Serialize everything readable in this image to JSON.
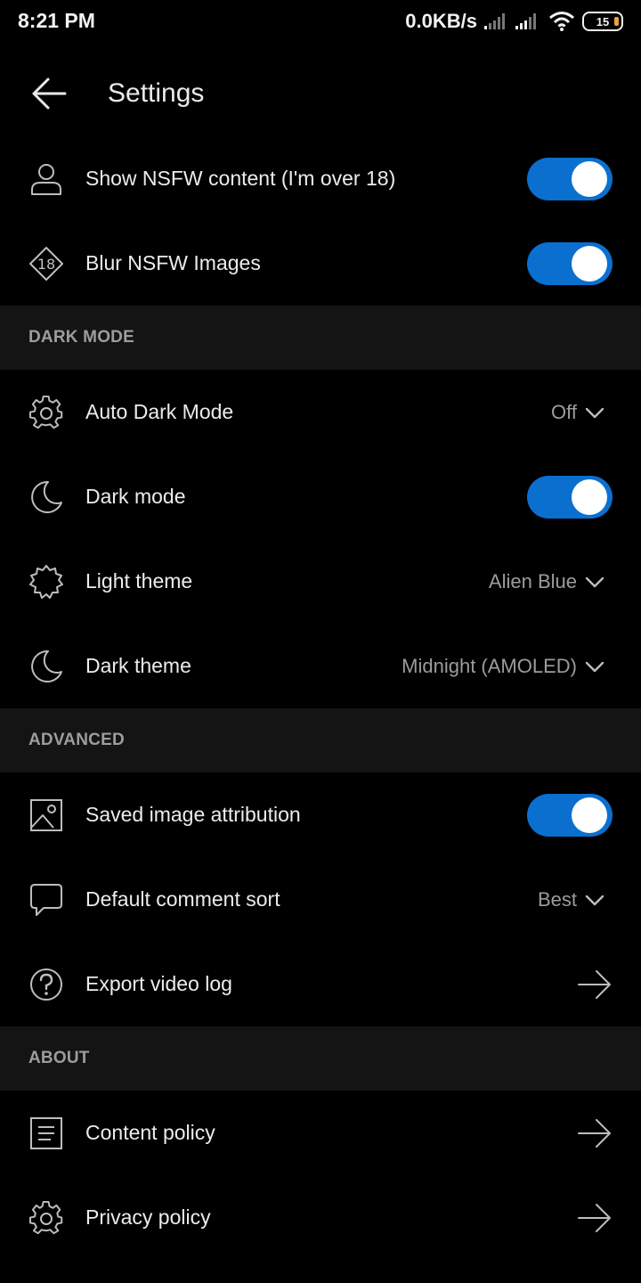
{
  "status": {
    "time": "8:21 PM",
    "speed": "0.0KB/s",
    "battery": "15"
  },
  "header": {
    "title": "Settings"
  },
  "nsfw": {
    "show_nsfw": {
      "label": "Show NSFW content (I'm over 18)",
      "on": true
    },
    "blur_nsfw": {
      "label": "Blur NSFW Images",
      "on": true
    }
  },
  "dark_mode": {
    "header": "DARK MODE",
    "auto_dark": {
      "label": "Auto Dark Mode",
      "value": "Off"
    },
    "dark_mode": {
      "label": "Dark mode",
      "on": true
    },
    "light_theme": {
      "label": "Light theme",
      "value": "Alien Blue"
    },
    "dark_theme": {
      "label": "Dark theme",
      "value": "Midnight (AMOLED)"
    }
  },
  "advanced": {
    "header": "ADVANCED",
    "saved_image": {
      "label": "Saved image attribution",
      "on": true
    },
    "comment_sort": {
      "label": "Default comment sort",
      "value": "Best"
    },
    "export_log": {
      "label": "Export video log"
    }
  },
  "about": {
    "header": "ABOUT",
    "content_policy": {
      "label": "Content policy"
    },
    "privacy_policy": {
      "label": "Privacy policy"
    }
  },
  "colors": {
    "background": "#000000",
    "section_bg": "#141414",
    "toggle_on": "#0b6fd0",
    "text_primary": "#ececec",
    "text_secondary": "#9c9c9c"
  }
}
